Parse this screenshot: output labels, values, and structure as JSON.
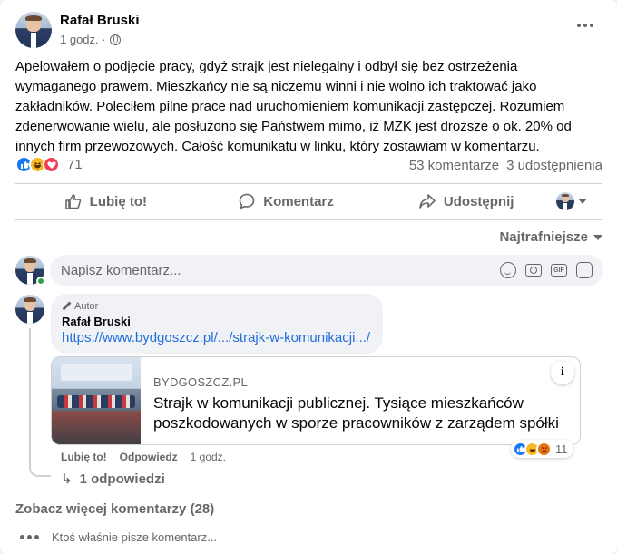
{
  "post": {
    "author": "Rafał Bruski",
    "time": "1 godz. ·",
    "text": "Apelowałem o podjęcie pracy, gdyż strajk jest nielegalny i odbył się bez ostrzeżenia wymaganego prawem. Mieszkańcy nie są niczemu winni i nie wolno ich traktować jako zakładników. Poleciłem pilne prace nad uruchomieniem komunikacji zastępczej. Rozumiem zdenerwowanie wielu, ale posłużono się Państwem mimo, iż MZK jest droższe o ok. 20% od innych firm przewozowych. Całość komunikatu w linku, który zostawiam w komentarzu.",
    "reaction_count": "71",
    "comments_count": "53 komentarze",
    "shares_count": "3 udostępnienia",
    "reaction_icons": [
      "like-icon",
      "haha-icon",
      "love-icon"
    ]
  },
  "actions": {
    "like": "Lubię to!",
    "comment": "Komentarz",
    "share": "Udostępnij"
  },
  "sort_label": "Najtrafniejsze",
  "composer": {
    "placeholder": "Napisz komentarz..."
  },
  "comment": {
    "badge": "Autor",
    "author": "Rafał Bruski",
    "link": "https://www.bydgoszcz.pl/.../strajk-w-komunikacji.../",
    "card": {
      "domain": "BYDGOSZCZ.PL",
      "title": "Strajk w komunikacji publicznej. Tysiące mieszkańców poszkodowanych w sporze pracowników z zarządem spółki"
    },
    "like": "Lubię to!",
    "reply": "Odpowiedz",
    "time": "1 godz.",
    "reaction_count": "11",
    "reaction_icons": [
      "like-icon",
      "haha-icon",
      "angry-icon"
    ],
    "replies_label": "1 odpowiedzi"
  },
  "more_comments": "Zobacz więcej komentarzy (28)",
  "typing": "Ktoś właśnie pisze komentarz...",
  "colors": {
    "brand_blue": "#1877f2",
    "link_blue": "#216fdb",
    "secondary_text": "#65676b",
    "online_green": "#31a24c"
  }
}
